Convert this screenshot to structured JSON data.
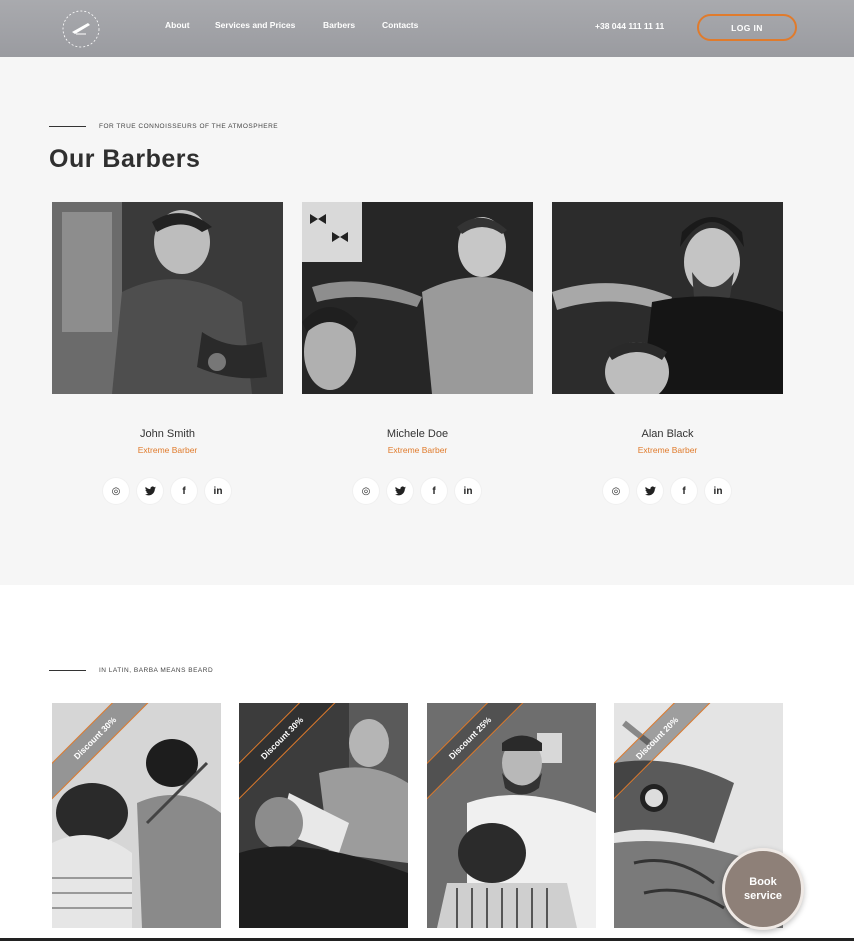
{
  "header": {
    "logo_icon": "razor-logo-icon",
    "logo_text": "GALLERY · STORE · & HOME",
    "nav": [
      {
        "label": "About"
      },
      {
        "label": "Services and Prices"
      },
      {
        "label": "Barbers"
      },
      {
        "label": "Contacts"
      }
    ],
    "phone": "+38 044 111 11 11",
    "login_label": "LOG IN",
    "accent": "#e07b2c"
  },
  "barbers": {
    "eyebrow": "FOR TRUE CONNOISSEURS OF THE ATMOSPHERE",
    "title": "Our Barbers",
    "items": [
      {
        "name": "John Smith",
        "role": "Extreme Barber"
      },
      {
        "name": "Michele Doe",
        "role": "Extreme Barber"
      },
      {
        "name": "Alan Black",
        "role": "Extreme Barber"
      }
    ],
    "social_icons": [
      "instagram-icon",
      "twitter-icon",
      "facebook-icon",
      "linkedin-icon"
    ],
    "social_glyphs": [
      "◎",
      "🐦",
      "f",
      "in"
    ]
  },
  "discounts": {
    "eyebrow": "IN LATIN, BARBA MEANS BEARD",
    "items": [
      {
        "label": "Discount 30%"
      },
      {
        "label": "Discount 30%"
      },
      {
        "label": "Discount 25%"
      },
      {
        "label": "Discount 20%"
      }
    ]
  },
  "book_button": {
    "line1": "Book",
    "line2": "service"
  }
}
